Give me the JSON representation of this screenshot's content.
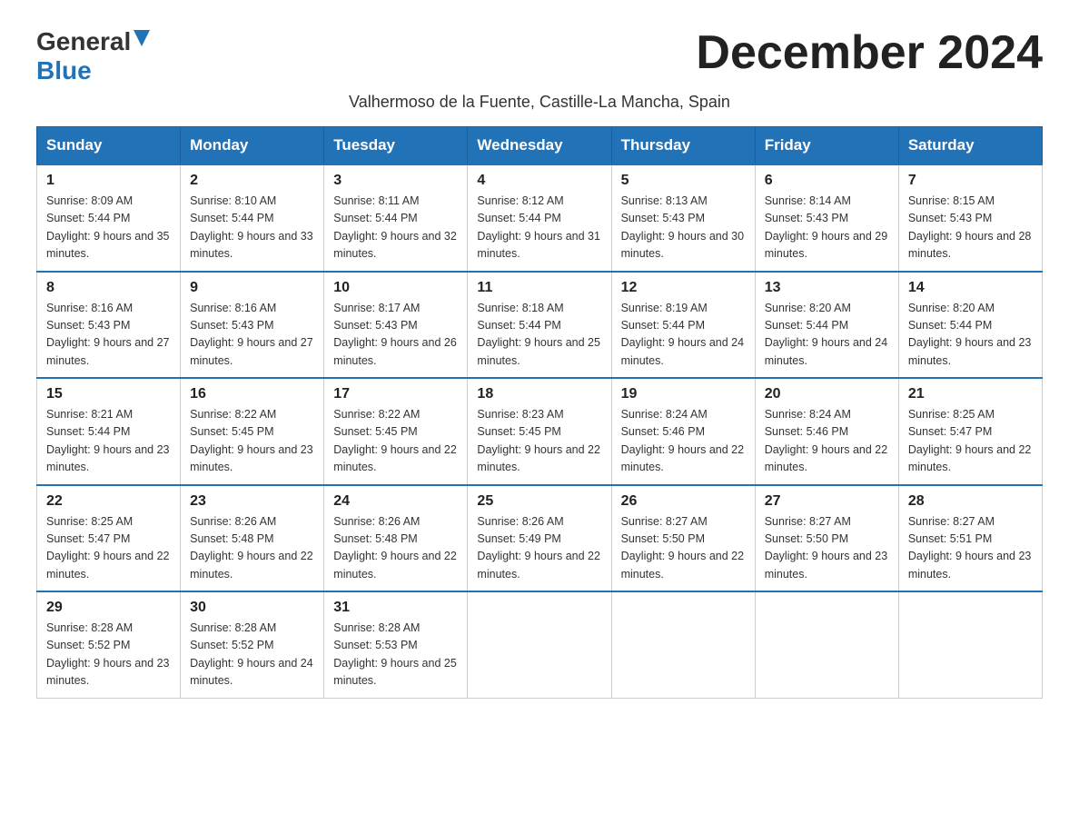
{
  "header": {
    "logo_general": "General",
    "logo_blue": "Blue",
    "month_title": "December 2024",
    "subtitle": "Valhermoso de la Fuente, Castille-La Mancha, Spain"
  },
  "days_of_week": [
    "Sunday",
    "Monday",
    "Tuesday",
    "Wednesday",
    "Thursday",
    "Friday",
    "Saturday"
  ],
  "weeks": [
    [
      {
        "day": "1",
        "sunrise": "8:09 AM",
        "sunset": "5:44 PM",
        "daylight": "9 hours and 35 minutes."
      },
      {
        "day": "2",
        "sunrise": "8:10 AM",
        "sunset": "5:44 PM",
        "daylight": "9 hours and 33 minutes."
      },
      {
        "day": "3",
        "sunrise": "8:11 AM",
        "sunset": "5:44 PM",
        "daylight": "9 hours and 32 minutes."
      },
      {
        "day": "4",
        "sunrise": "8:12 AM",
        "sunset": "5:44 PM",
        "daylight": "9 hours and 31 minutes."
      },
      {
        "day": "5",
        "sunrise": "8:13 AM",
        "sunset": "5:43 PM",
        "daylight": "9 hours and 30 minutes."
      },
      {
        "day": "6",
        "sunrise": "8:14 AM",
        "sunset": "5:43 PM",
        "daylight": "9 hours and 29 minutes."
      },
      {
        "day": "7",
        "sunrise": "8:15 AM",
        "sunset": "5:43 PM",
        "daylight": "9 hours and 28 minutes."
      }
    ],
    [
      {
        "day": "8",
        "sunrise": "8:16 AM",
        "sunset": "5:43 PM",
        "daylight": "9 hours and 27 minutes."
      },
      {
        "day": "9",
        "sunrise": "8:16 AM",
        "sunset": "5:43 PM",
        "daylight": "9 hours and 27 minutes."
      },
      {
        "day": "10",
        "sunrise": "8:17 AM",
        "sunset": "5:43 PM",
        "daylight": "9 hours and 26 minutes."
      },
      {
        "day": "11",
        "sunrise": "8:18 AM",
        "sunset": "5:44 PM",
        "daylight": "9 hours and 25 minutes."
      },
      {
        "day": "12",
        "sunrise": "8:19 AM",
        "sunset": "5:44 PM",
        "daylight": "9 hours and 24 minutes."
      },
      {
        "day": "13",
        "sunrise": "8:20 AM",
        "sunset": "5:44 PM",
        "daylight": "9 hours and 24 minutes."
      },
      {
        "day": "14",
        "sunrise": "8:20 AM",
        "sunset": "5:44 PM",
        "daylight": "9 hours and 23 minutes."
      }
    ],
    [
      {
        "day": "15",
        "sunrise": "8:21 AM",
        "sunset": "5:44 PM",
        "daylight": "9 hours and 23 minutes."
      },
      {
        "day": "16",
        "sunrise": "8:22 AM",
        "sunset": "5:45 PM",
        "daylight": "9 hours and 23 minutes."
      },
      {
        "day": "17",
        "sunrise": "8:22 AM",
        "sunset": "5:45 PM",
        "daylight": "9 hours and 22 minutes."
      },
      {
        "day": "18",
        "sunrise": "8:23 AM",
        "sunset": "5:45 PM",
        "daylight": "9 hours and 22 minutes."
      },
      {
        "day": "19",
        "sunrise": "8:24 AM",
        "sunset": "5:46 PM",
        "daylight": "9 hours and 22 minutes."
      },
      {
        "day": "20",
        "sunrise": "8:24 AM",
        "sunset": "5:46 PM",
        "daylight": "9 hours and 22 minutes."
      },
      {
        "day": "21",
        "sunrise": "8:25 AM",
        "sunset": "5:47 PM",
        "daylight": "9 hours and 22 minutes."
      }
    ],
    [
      {
        "day": "22",
        "sunrise": "8:25 AM",
        "sunset": "5:47 PM",
        "daylight": "9 hours and 22 minutes."
      },
      {
        "day": "23",
        "sunrise": "8:26 AM",
        "sunset": "5:48 PM",
        "daylight": "9 hours and 22 minutes."
      },
      {
        "day": "24",
        "sunrise": "8:26 AM",
        "sunset": "5:48 PM",
        "daylight": "9 hours and 22 minutes."
      },
      {
        "day": "25",
        "sunrise": "8:26 AM",
        "sunset": "5:49 PM",
        "daylight": "9 hours and 22 minutes."
      },
      {
        "day": "26",
        "sunrise": "8:27 AM",
        "sunset": "5:50 PM",
        "daylight": "9 hours and 22 minutes."
      },
      {
        "day": "27",
        "sunrise": "8:27 AM",
        "sunset": "5:50 PM",
        "daylight": "9 hours and 23 minutes."
      },
      {
        "day": "28",
        "sunrise": "8:27 AM",
        "sunset": "5:51 PM",
        "daylight": "9 hours and 23 minutes."
      }
    ],
    [
      {
        "day": "29",
        "sunrise": "8:28 AM",
        "sunset": "5:52 PM",
        "daylight": "9 hours and 23 minutes."
      },
      {
        "day": "30",
        "sunrise": "8:28 AM",
        "sunset": "5:52 PM",
        "daylight": "9 hours and 24 minutes."
      },
      {
        "day": "31",
        "sunrise": "8:28 AM",
        "sunset": "5:53 PM",
        "daylight": "9 hours and 25 minutes."
      },
      null,
      null,
      null,
      null
    ]
  ],
  "labels": {
    "sunrise_prefix": "Sunrise: ",
    "sunset_prefix": "Sunset: ",
    "daylight_prefix": "Daylight: "
  }
}
